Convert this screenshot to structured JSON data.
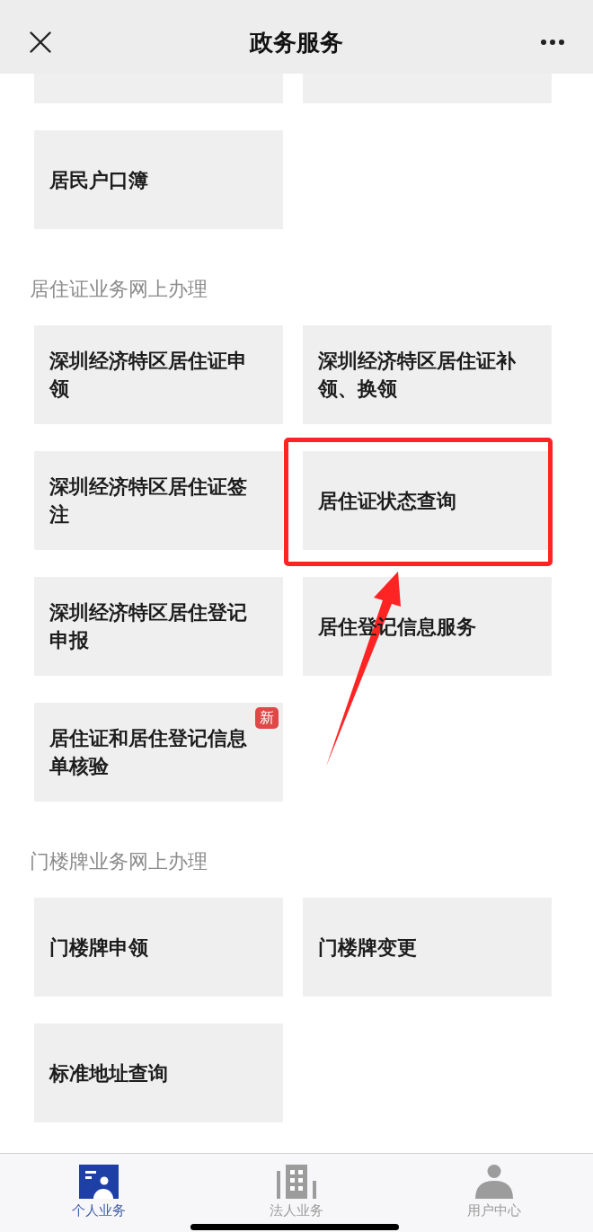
{
  "header": {
    "title": "政务服务"
  },
  "sections": [
    {
      "tiles": [
        {
          "kind": "cut"
        },
        {
          "kind": "cut"
        },
        {
          "kind": "tile",
          "label": "居民户口簿",
          "highlighted": false
        }
      ]
    },
    {
      "title": "居住证业务网上办理",
      "tiles": [
        {
          "kind": "tile",
          "label": "深圳经济特区居住证申领",
          "highlighted": false
        },
        {
          "kind": "tile",
          "label": "深圳经济特区居住证补领、换领",
          "highlighted": false
        },
        {
          "kind": "tile",
          "label": "深圳经济特区居住证签注",
          "highlighted": false
        },
        {
          "kind": "tile",
          "label": "居住证状态查询",
          "highlighted": true
        },
        {
          "kind": "tile",
          "label": "深圳经济特区居住登记申报",
          "highlighted": false
        },
        {
          "kind": "tile",
          "label": "居住登记信息服务",
          "highlighted": false
        },
        {
          "kind": "tile",
          "label": "居住证和居住登记信息单核验",
          "badge": "新",
          "highlighted": false
        }
      ]
    },
    {
      "title": "门楼牌业务网上办理",
      "tiles": [
        {
          "kind": "tile",
          "label": "门楼牌申领",
          "highlighted": false
        },
        {
          "kind": "tile",
          "label": "门楼牌变更",
          "highlighted": false
        },
        {
          "kind": "tile",
          "label": "标准地址查询",
          "highlighted": false
        }
      ]
    }
  ],
  "tab_bar": [
    {
      "kind": "person-card",
      "label": "个人业务",
      "selected": true
    },
    {
      "kind": "building",
      "label": "法人业务",
      "selected": false
    },
    {
      "kind": "person",
      "label": "用户中心",
      "selected": false
    }
  ]
}
